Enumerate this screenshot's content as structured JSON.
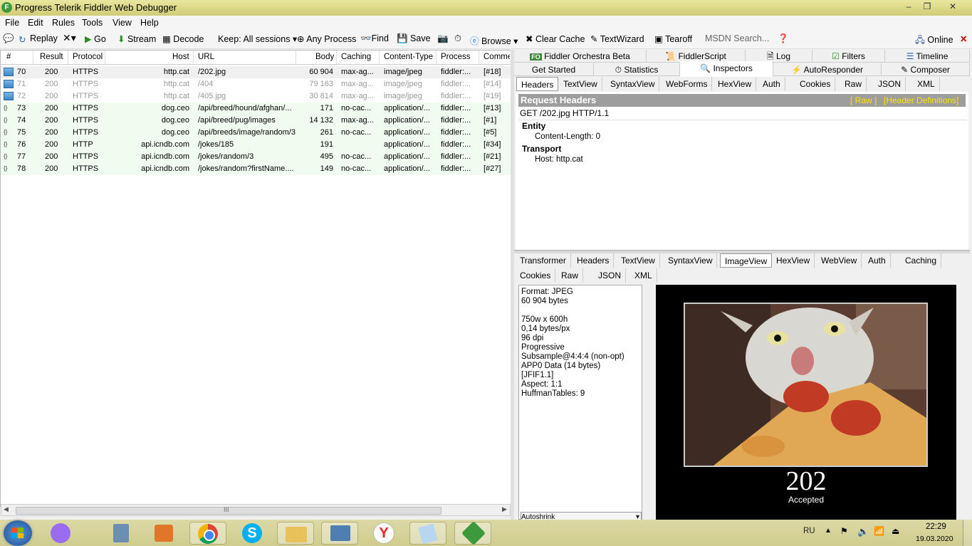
{
  "window": {
    "title": "Progress Telerik Fiddler Web Debugger",
    "controls": {
      "minimize": "–",
      "maximize": "❐",
      "close": "✕"
    }
  },
  "menu": [
    "File",
    "Edit",
    "Rules",
    "Tools",
    "View",
    "Help"
  ],
  "toolbar": {
    "replay": "Replay",
    "go": "Go",
    "stream": "Stream",
    "decode": "Decode",
    "keep": "Keep: All sessions",
    "process": "Any Process",
    "find": "Find",
    "save": "Save",
    "browse": "Browse",
    "clear_cache": "Clear Cache",
    "textwizard": "TextWizard",
    "tearoff": "Tearoff",
    "msdn": "MSDN Search...",
    "online": "Online"
  },
  "grid": {
    "columns": [
      "#",
      "Result",
      "Protocol",
      "Host",
      "URL",
      "Body",
      "Caching",
      "Content-Type",
      "Process",
      "Commen"
    ],
    "rows": [
      {
        "num": "70",
        "result": "200",
        "protocol": "HTTPS",
        "host": "http.cat",
        "url": "/202.jpg",
        "body": "60 904",
        "caching": "max-ag...",
        "ctype": "image/jpeg",
        "process": "fiddler:...",
        "comment": "[#18]",
        "icon": "image",
        "style": "sel"
      },
      {
        "num": "71",
        "result": "200",
        "protocol": "HTTPS",
        "host": "http.cat",
        "url": "/404",
        "body": "79 163",
        "caching": "max-ag...",
        "ctype": "image/jpeg",
        "process": "fiddler:...",
        "comment": "[#14]",
        "icon": "image",
        "style": "grey"
      },
      {
        "num": "72",
        "result": "200",
        "protocol": "HTTPS",
        "host": "http.cat",
        "url": "/405.jpg",
        "body": "30 814",
        "caching": "max-ag...",
        "ctype": "image/jpeg",
        "process": "fiddler:...",
        "comment": "[#19]",
        "icon": "image",
        "style": "grey"
      },
      {
        "num": "73",
        "result": "200",
        "protocol": "HTTPS",
        "host": "dog.ceo",
        "url": "/api/breed/hound/afghan/...",
        "body": "171",
        "caching": "no-cac...",
        "ctype": "application/...",
        "process": "fiddler:...",
        "comment": "[#13]",
        "icon": "json",
        "style": "green"
      },
      {
        "num": "74",
        "result": "200",
        "protocol": "HTTPS",
        "host": "dog.ceo",
        "url": "/api/breed/pug/images",
        "body": "14 132",
        "caching": "max-ag...",
        "ctype": "application/...",
        "process": "fiddler:...",
        "comment": "[#1]",
        "icon": "json",
        "style": "green"
      },
      {
        "num": "75",
        "result": "200",
        "protocol": "HTTPS",
        "host": "dog.ceo",
        "url": "/api/breeds/image/random/3",
        "body": "261",
        "caching": "no-cac...",
        "ctype": "application/...",
        "process": "fiddler:...",
        "comment": "[#5]",
        "icon": "json",
        "style": "green"
      },
      {
        "num": "76",
        "result": "200",
        "protocol": "HTTP",
        "host": "api.icndb.com",
        "url": "/jokes/185",
        "body": "191",
        "caching": "",
        "ctype": "application/...",
        "process": "fiddler:...",
        "comment": "[#34]",
        "icon": "json",
        "style": "green"
      },
      {
        "num": "77",
        "result": "200",
        "protocol": "HTTPS",
        "host": "api.icndb.com",
        "url": "/jokes/random/3",
        "body": "495",
        "caching": "no-cac...",
        "ctype": "application/...",
        "process": "fiddler:...",
        "comment": "[#21]",
        "icon": "json",
        "style": "green"
      },
      {
        "num": "78",
        "result": "200",
        "protocol": "HTTPS",
        "host": "api.icndb.com",
        "url": "/jokes/random?firstName....",
        "body": "149",
        "caching": "no-cac...",
        "ctype": "application/...",
        "process": "fiddler:...",
        "comment": "[#27]",
        "icon": "json",
        "style": "green"
      }
    ],
    "scroll_grip": "III"
  },
  "top_tabs_row1": [
    "Fiddler Orchestra Beta",
    "FiddlerScript",
    "Log",
    "Filters",
    "Timeline"
  ],
  "top_tabs_row2": [
    "Get Started",
    "Statistics",
    "Inspectors",
    "AutoResponder",
    "Composer"
  ],
  "request_tabs": [
    "Headers",
    "TextView",
    "SyntaxView",
    "WebForms",
    "HexView",
    "Auth",
    "Cookies",
    "Raw",
    "JSON",
    "XML"
  ],
  "request": {
    "title": "Request Headers",
    "raw_link": "[ Raw ]",
    "defs_link": "[Header Definitions]",
    "line": "GET /202.jpg HTTP/1.1",
    "entity_label": "Entity",
    "entity_value": "Content-Length: 0",
    "transport_label": "Transport",
    "transport_value": "Host: http.cat"
  },
  "response_tabs_row1": [
    "Transformer",
    "Headers",
    "TextView",
    "SyntaxView",
    "ImageView",
    "HexView",
    "WebView",
    "Auth",
    "Caching"
  ],
  "response_tabs_row2": [
    "Cookies",
    "Raw",
    "JSON",
    "XML"
  ],
  "image_meta": [
    "Format: JPEG",
    "60 904 bytes",
    "",
    "750w x 600h",
    "0,14 bytes/px",
    "96 dpi",
    "Progressive",
    "Subsample@4:4:4 (non-opt)",
    "APP0 Data (14 bytes)",
    "[JFIF1.1]",
    "Aspect: 1:1",
    "HuffmanTables: 9"
  ],
  "autoshrink": "Autoshrink",
  "image": {
    "code": "202",
    "caption": "Accepted"
  },
  "taskbar": {
    "lang": "RU",
    "time": "22:29",
    "date": "19.03.2020"
  },
  "colors": {
    "accent_yellow": "#ffe400",
    "grid_green": "#f0fcf0",
    "titlebar": "#ddd98a"
  }
}
